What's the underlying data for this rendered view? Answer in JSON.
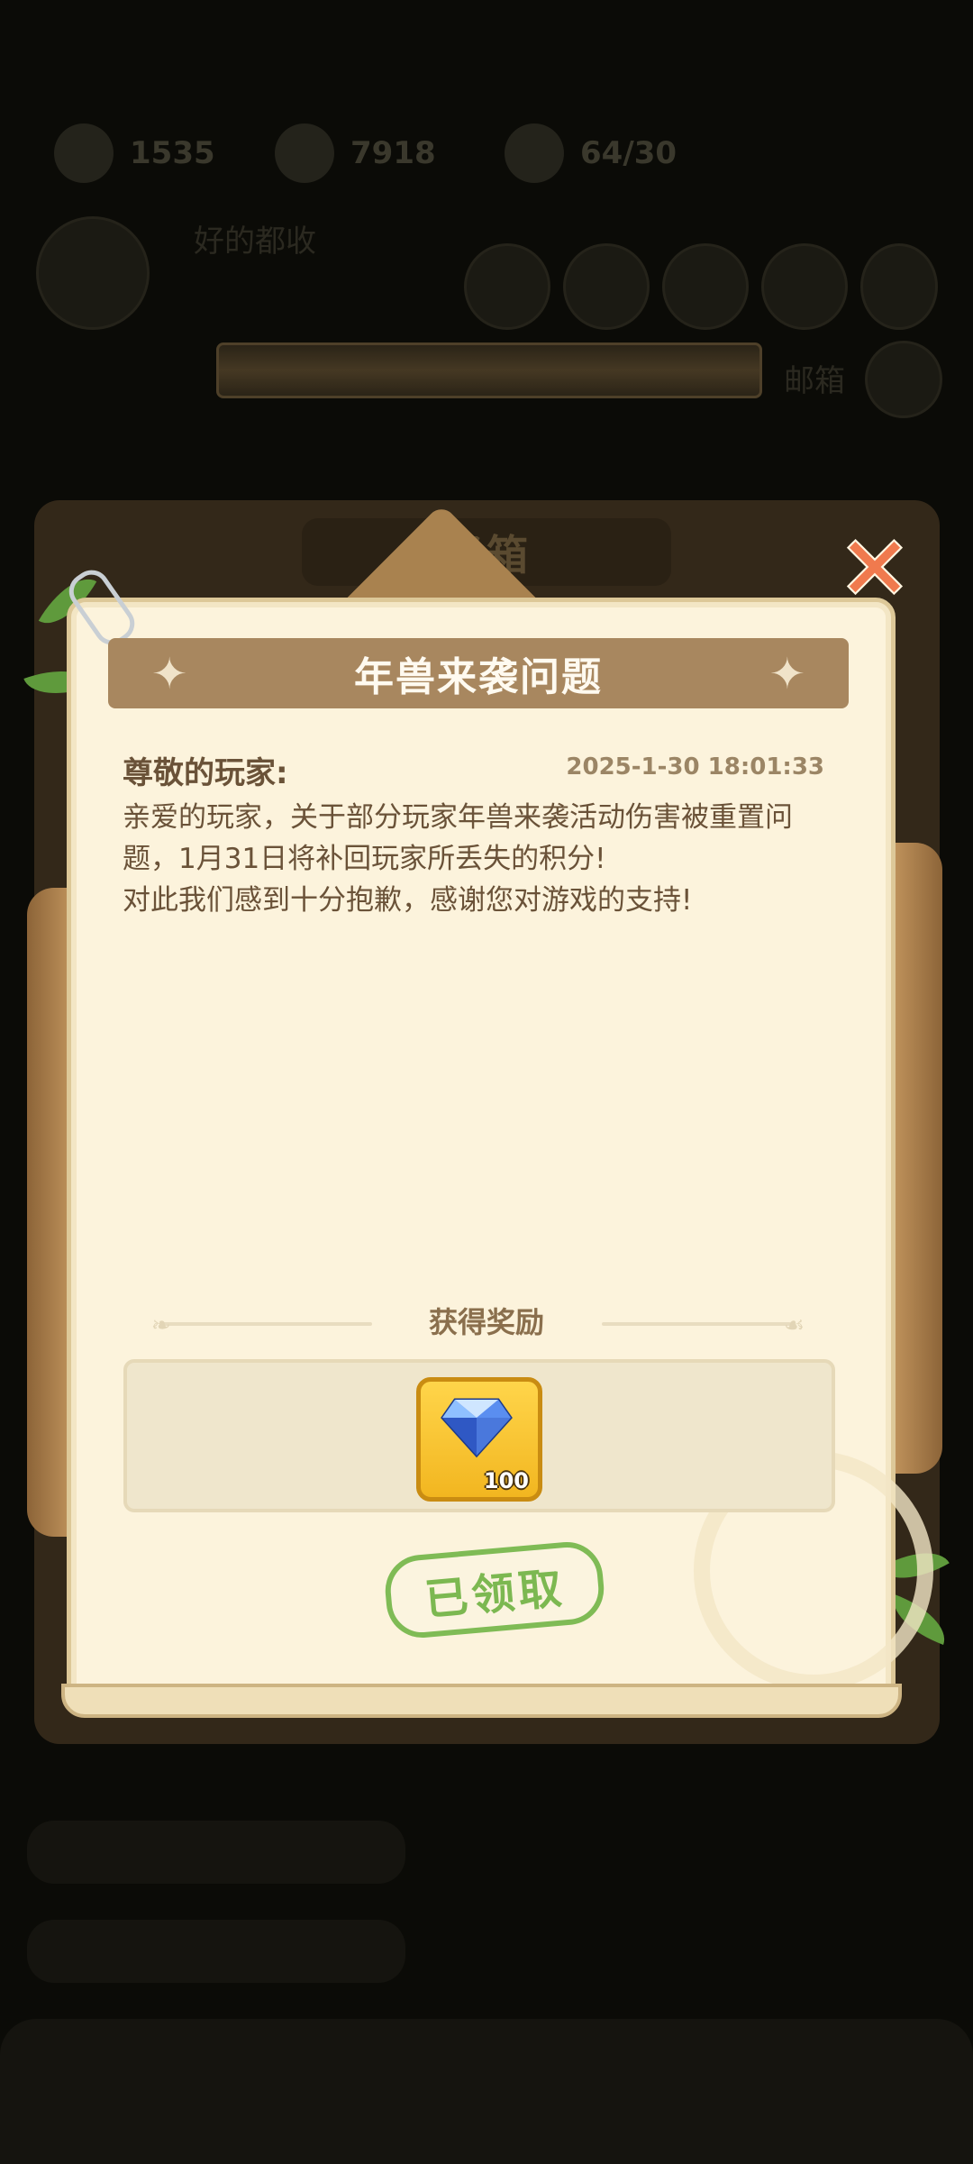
{
  "background": {
    "resources": [
      "1535",
      "7918",
      "64/30"
    ],
    "player_name": "好的都收",
    "mail_label": "邮箱"
  },
  "modal": {
    "header": "邮箱",
    "close_icon": "close-x-icon",
    "mail": {
      "title": "年兽来袭问题",
      "greeting": "尊敬的玩家:",
      "timestamp": "2025-1-30 18:01:33",
      "body": "亲爱的玩家，关于部分玩家年兽来袭活动伤害被重置问题，1月31日将补回玩家所丢失的积分!\n对此我们感到十分抱歉，感谢您对游戏的支持!"
    },
    "rewards": {
      "title": "获得奖励",
      "items": [
        {
          "icon": "diamond-icon",
          "count": "100"
        }
      ]
    },
    "claim_status": "已领取"
  },
  "colors": {
    "banner": "#a8875f",
    "paper": "#fcf3dc",
    "claimed_green": "#7cb851",
    "close_red": "#f07a4e"
  }
}
